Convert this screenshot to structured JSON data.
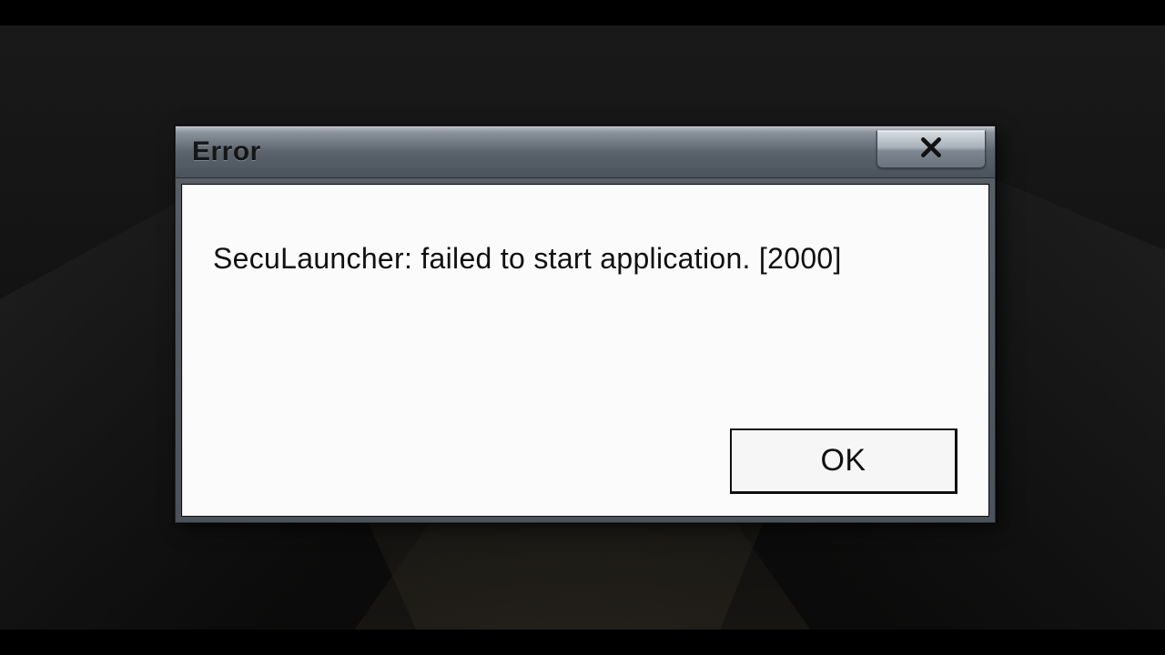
{
  "dialog": {
    "title": "Error",
    "message": "SecuLauncher: failed to start application. [2000]",
    "buttons": {
      "ok": "OK"
    }
  }
}
